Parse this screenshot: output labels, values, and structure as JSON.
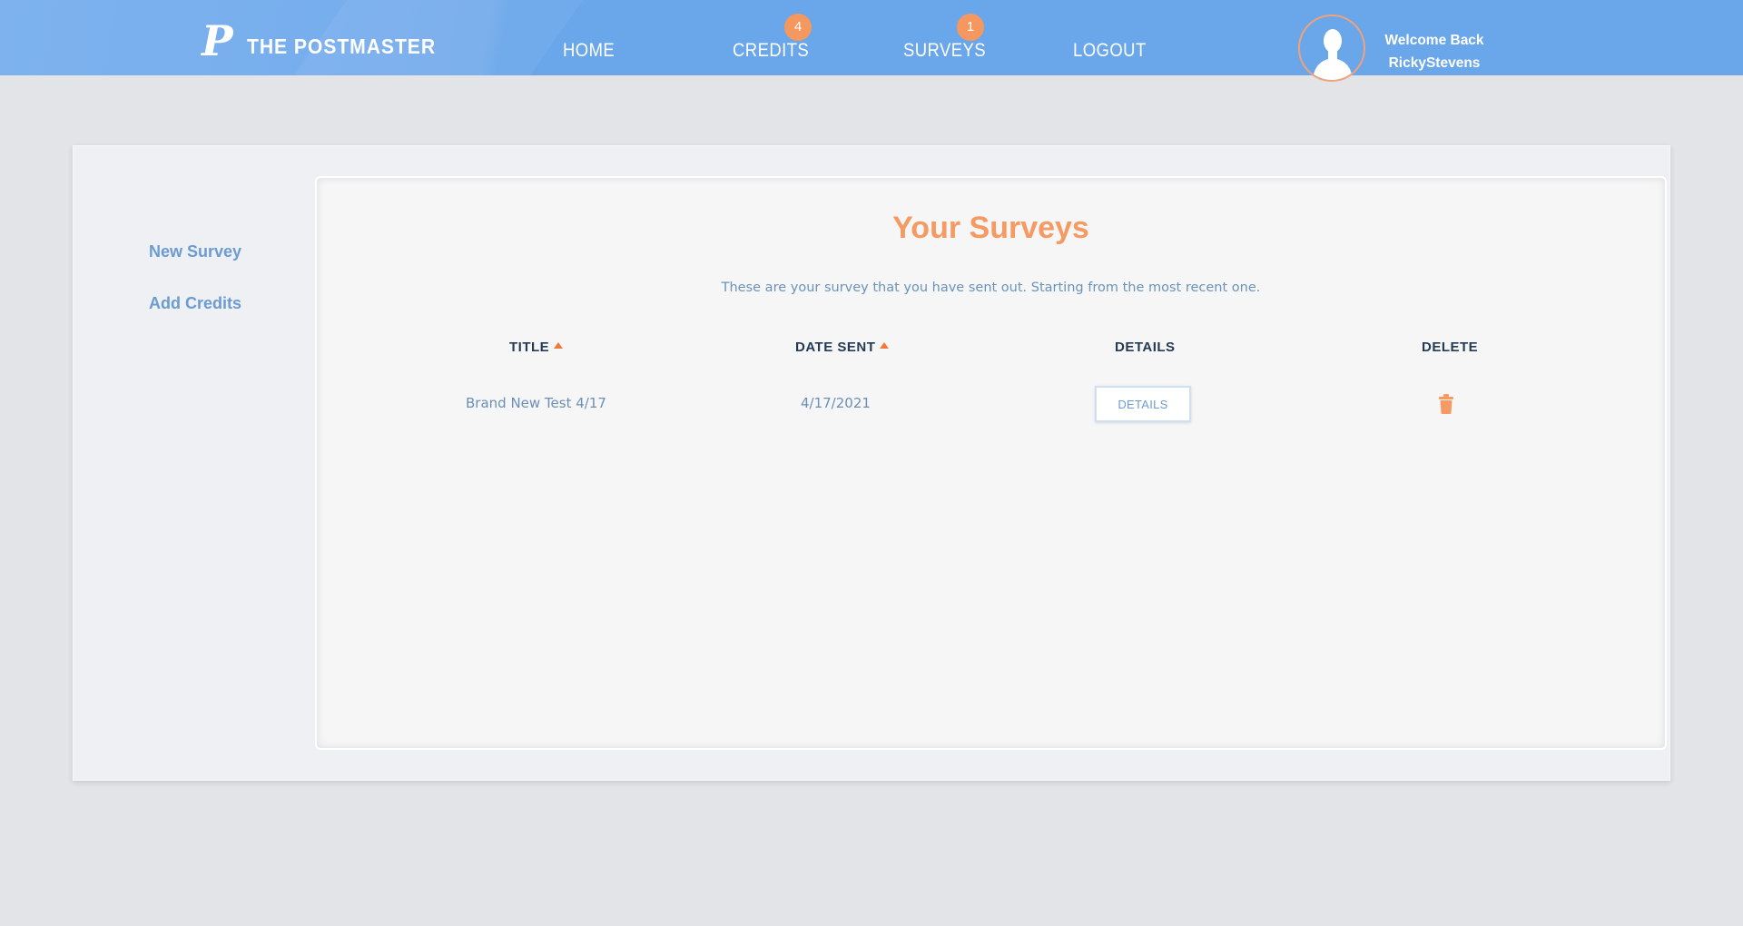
{
  "header": {
    "brand": "THE POSTMASTER",
    "logo_letter": "P",
    "nav": {
      "home": "HOME",
      "credits": "CREDITS",
      "credits_badge": "4",
      "surveys": "SURVEYS",
      "surveys_badge": "1",
      "logout": "LOGOUT"
    },
    "welcome_line1": "Welcome Back",
    "username": "RickyStevens"
  },
  "sidebar": {
    "items": [
      {
        "label": "New Survey"
      },
      {
        "label": "Add Credits"
      }
    ]
  },
  "main": {
    "title": "Your Surveys",
    "subtitle": "These are your survey that you have sent out. Starting from the most recent one.",
    "table": {
      "headers": {
        "title": "TITLE",
        "date_sent": "DATE SENT",
        "details": "DETAILS",
        "delete": "DELETE"
      },
      "rows": [
        {
          "title": "Brand New Test 4/17",
          "date_sent": "4/17/2021",
          "details_button": "DETAILS"
        }
      ]
    }
  },
  "colors": {
    "header_blue": "#6aa6ea",
    "accent_orange": "#f59a62",
    "link_blue": "#6b9bd0"
  },
  "icons": {
    "logo": "postmaster-p-logo",
    "avatar": "user-silhouette-icon",
    "sort": "sort-ascending-icon",
    "delete": "trash-icon"
  }
}
